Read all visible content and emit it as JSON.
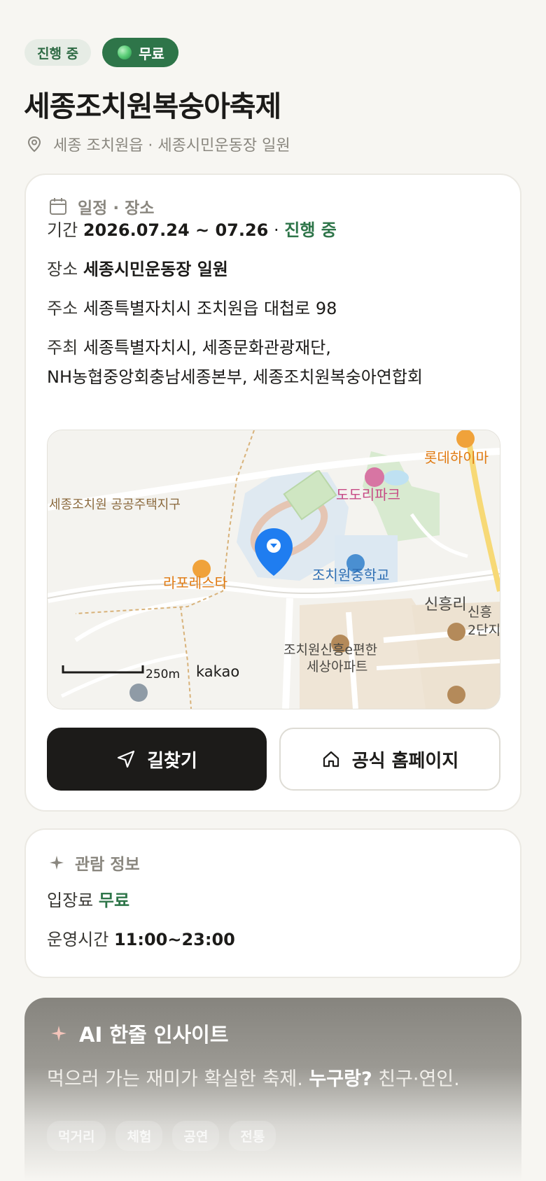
{
  "badges": {
    "status": "진행 중",
    "price": "무료"
  },
  "title": "세종조치원복숭아축제",
  "location": "세종 조치원읍 · 세종시민운동장 일원",
  "schedule": {
    "heading": "일정 · 장소",
    "period_label": "기간",
    "period_value": "2026.07.24 ~ 07.26",
    "period_sep": "·",
    "period_status": "진행 중",
    "place_label": "장소",
    "place_value": "세종시민운동장 일원",
    "address_label": "주소",
    "address_value": "세종특별자치시 조치원읍 대첩로 98",
    "host_label": "주최",
    "host_line1": "세종특별자치시, 세종문화관광재단,",
    "host_line2": "NH농협중앙회충남세종본부, 세종조치원복숭아연합회"
  },
  "map": {
    "labels": {
      "lotte": "롯데하이마",
      "dodori": "도도리파크",
      "housing": "세종조치원 공공주택지구",
      "laforesta": "라포레스타",
      "school": "조치원중학교",
      "sinheung_ri": "신흥리",
      "sinheung_2dan_a": "신흥",
      "sinheung_2dan_b": "2단지",
      "apt_a": "조치원신흥e편한",
      "apt_b": "세상아파트",
      "scale": "250m",
      "brand": "kakao"
    }
  },
  "buttons": {
    "directions": "길찾기",
    "homepage": "공식 홈페이지"
  },
  "viewing": {
    "heading": "관람 정보",
    "fee_label": "입장료",
    "fee_value": "무료",
    "hours_label": "운영시간",
    "hours_value": "11:00~23:00"
  },
  "ai": {
    "heading": "AI 한줄 인사이트",
    "text_main": "먹으러 가는 재미가 확실한 축제. ",
    "text_bold": "누구랑?",
    "text_tail": " 친구·연인.",
    "chips": [
      "먹거리",
      "체험",
      "공연",
      "전통"
    ]
  },
  "colors": {
    "accent_green": "#2e7549",
    "dark_button": "#1c1b19",
    "badge_bg": "#e6ece5"
  }
}
